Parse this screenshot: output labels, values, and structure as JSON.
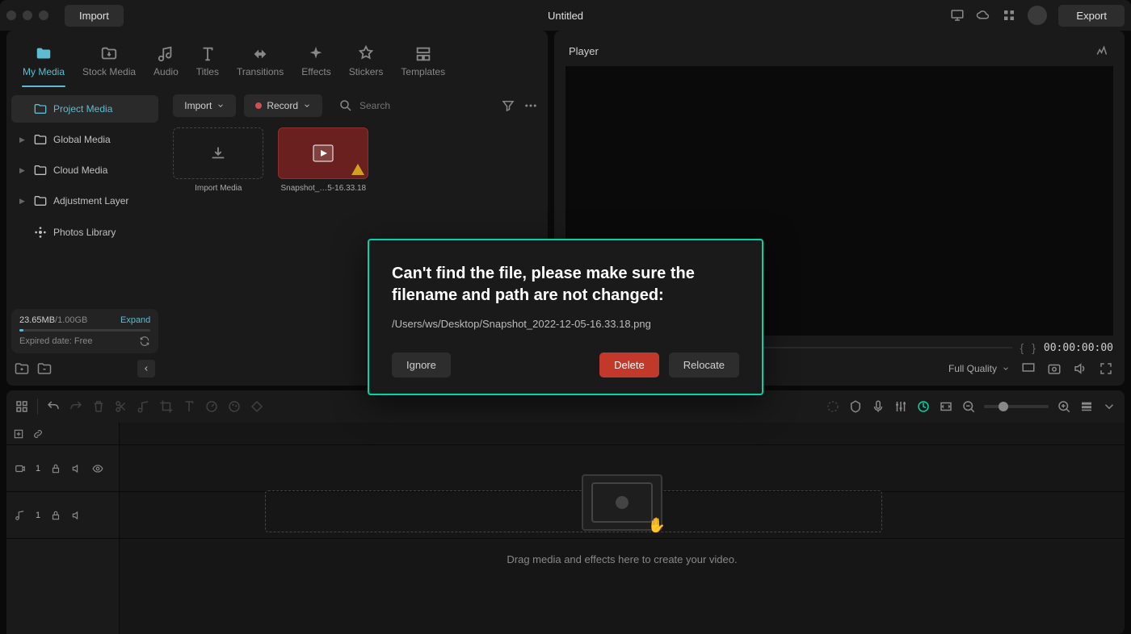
{
  "title_bar": {
    "import_label": "Import",
    "title": "Untitled",
    "export_label": "Export"
  },
  "tabs": [
    {
      "label": "My Media"
    },
    {
      "label": "Stock Media"
    },
    {
      "label": "Audio"
    },
    {
      "label": "Titles"
    },
    {
      "label": "Transitions"
    },
    {
      "label": "Effects"
    },
    {
      "label": "Stickers"
    },
    {
      "label": "Templates"
    }
  ],
  "sidebar": {
    "items": [
      {
        "label": "Project Media"
      },
      {
        "label": "Global Media"
      },
      {
        "label": "Cloud Media"
      },
      {
        "label": "Adjustment Layer"
      },
      {
        "label": "Photos Library"
      }
    ]
  },
  "storage": {
    "used": "23.65MB",
    "total": "/1.00GB",
    "expand": "Expand",
    "expired": "Expired date: Free"
  },
  "content_toolbar": {
    "import_label": "Import",
    "record_label": "Record",
    "search_placeholder": "Search"
  },
  "media": {
    "import_tile": "Import Media",
    "clip_name": "Snapshot_…5-16.33.18"
  },
  "player": {
    "title": "Player",
    "timecode": "00:00:00:00",
    "quality": "Full Quality"
  },
  "timeline": {
    "track1": "1",
    "track2": "1",
    "hint": "Drag media and effects here to create your video."
  },
  "modal": {
    "title": "Can't find the file, please make sure the filename and path are not changed:",
    "path": "/Users/ws/Desktop/Snapshot_2022-12-05-16.33.18.png",
    "ignore": "Ignore",
    "delete": "Delete",
    "relocate": "Relocate"
  }
}
